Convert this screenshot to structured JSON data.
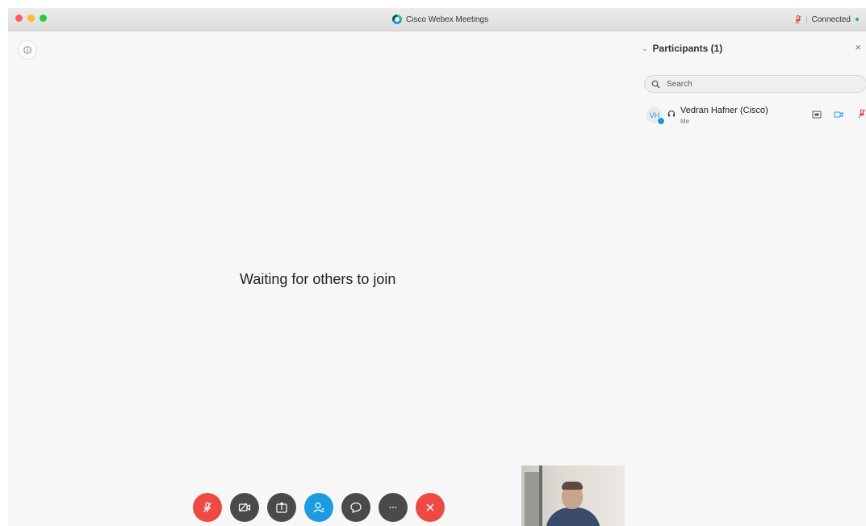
{
  "window": {
    "title": "Cisco Webex Meetings",
    "status": "Connected"
  },
  "main": {
    "waiting_text": "Waiting for others to join"
  },
  "participants_panel": {
    "title": "Participants (1)",
    "search_placeholder": "Search",
    "participants": [
      {
        "initials": "VH",
        "name": "Vedran Hafner (Cisco)",
        "subtitle": "Me"
      }
    ]
  },
  "controls": [
    {
      "name": "mute",
      "color": "#ec4a42",
      "icon": "microphone-muted-icon"
    },
    {
      "name": "video",
      "color": "#4a4a4a",
      "icon": "video-off-icon"
    },
    {
      "name": "share",
      "color": "#4a4a4a",
      "icon": "share-icon"
    },
    {
      "name": "participants",
      "color": "#1d9be0",
      "icon": "participants-icon"
    },
    {
      "name": "chat",
      "color": "#4a4a4a",
      "icon": "chat-icon"
    },
    {
      "name": "more",
      "color": "#4a4a4a",
      "icon": "more-icon"
    },
    {
      "name": "leave",
      "color": "#ec4a42",
      "icon": "close-icon"
    }
  ],
  "colors": {
    "accent": "#1d9be0",
    "danger": "#ec4a42",
    "connected": "#2bb24c"
  }
}
